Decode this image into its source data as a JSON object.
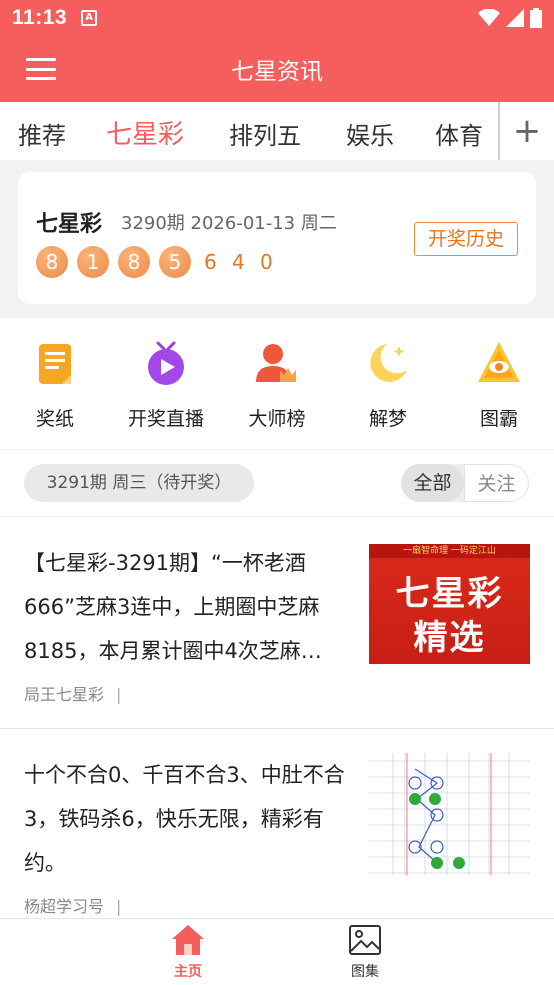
{
  "status_bar": {
    "time": "11:13",
    "app_badge": "A"
  },
  "header": {
    "title": "七星资讯"
  },
  "tabs": [
    {
      "label": "推荐"
    },
    {
      "label": "七星彩",
      "active": true
    },
    {
      "label": "排列五"
    },
    {
      "label": "娱乐"
    },
    {
      "label": "体育"
    }
  ],
  "tabs_plus": "+",
  "lottery": {
    "name": "七星彩",
    "issue_info": "3290期 2026-01-13 周二",
    "ball_numbers": [
      "8",
      "1",
      "8",
      "5"
    ],
    "plain_numbers": [
      "6",
      "4",
      "0"
    ],
    "history_button": "开奖历史"
  },
  "features": [
    {
      "label": "奖纸",
      "icon": "paper-icon"
    },
    {
      "label": "开奖直播",
      "icon": "live-tv-icon"
    },
    {
      "label": "大师榜",
      "icon": "master-rank-icon"
    },
    {
      "label": "解梦",
      "icon": "moon-icon"
    },
    {
      "label": "图霸",
      "icon": "pyramid-eye-icon"
    }
  ],
  "filter": {
    "issue_label": "3291期 周三（待开奖）",
    "segments": [
      "全部",
      "关注"
    ]
  },
  "articles": [
    {
      "title": "【七星彩-3291期】“一杯老酒666”芝麻3连中，上期圈中芝麻8185，本月累计圈中4次芝麻…",
      "source": "局王七星彩",
      "thumb_band": "一扇智命理  一码定江山",
      "thumb_line1": "七星彩",
      "thumb_line2": "精选"
    },
    {
      "title": "十个不合0、千百不合3、中肚不合3，铁码杀6，快乐无限，精彩有约。",
      "source": "杨超学习号"
    }
  ],
  "separator": "|",
  "bottom_nav": [
    {
      "label": "主页",
      "icon": "home-icon",
      "active": true
    },
    {
      "label": "图集",
      "icon": "gallery-icon"
    }
  ],
  "colors": {
    "brand": "#f65d5d",
    "ball": "#ef8a4a",
    "plain_number": "#e8741f"
  }
}
